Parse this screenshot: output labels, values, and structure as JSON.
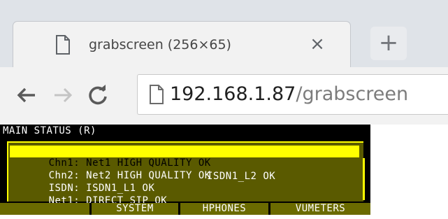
{
  "browser": {
    "tab": {
      "title": "grabscreen (256×65)",
      "close_glyph": "×",
      "icon": "file-icon"
    },
    "new_tab_glyph": "+",
    "toolbar": {
      "back_icon": "back-arrow-icon",
      "forward_icon": "forward-arrow-icon",
      "reload_icon": "reload-icon"
    },
    "address": {
      "host": "192.168.1.87",
      "path": "/grabscreen",
      "icon": "page-icon"
    }
  },
  "device_screen": {
    "header": "MAIN STATUS (R)",
    "rows": [
      {
        "col1": "Chn1: Net1 HIGH QUALITY OK",
        "col2": "",
        "selected": true
      },
      {
        "col1": "Chn2: Net2 HIGH QUALITY OK",
        "col2": "",
        "selected": false
      },
      {
        "col1": "ISDN: ISDN1_L1 OK",
        "col2": "ISDN1_L2 OK",
        "selected": false
      },
      {
        "col1": "Net1: DIRECT SIP OK",
        "col2": "",
        "selected": false
      }
    ],
    "softkeys": [
      "",
      "SYSTEM",
      "HPHONES",
      "VUMETERS"
    ]
  },
  "colors": {
    "lcd_background": "#000000",
    "highlight": "#ffff00",
    "panel": "#5a5a00",
    "softkey": "#6b6b00",
    "tabstrip": "#dfe3e8",
    "toolbar": "#f2f2f2"
  }
}
